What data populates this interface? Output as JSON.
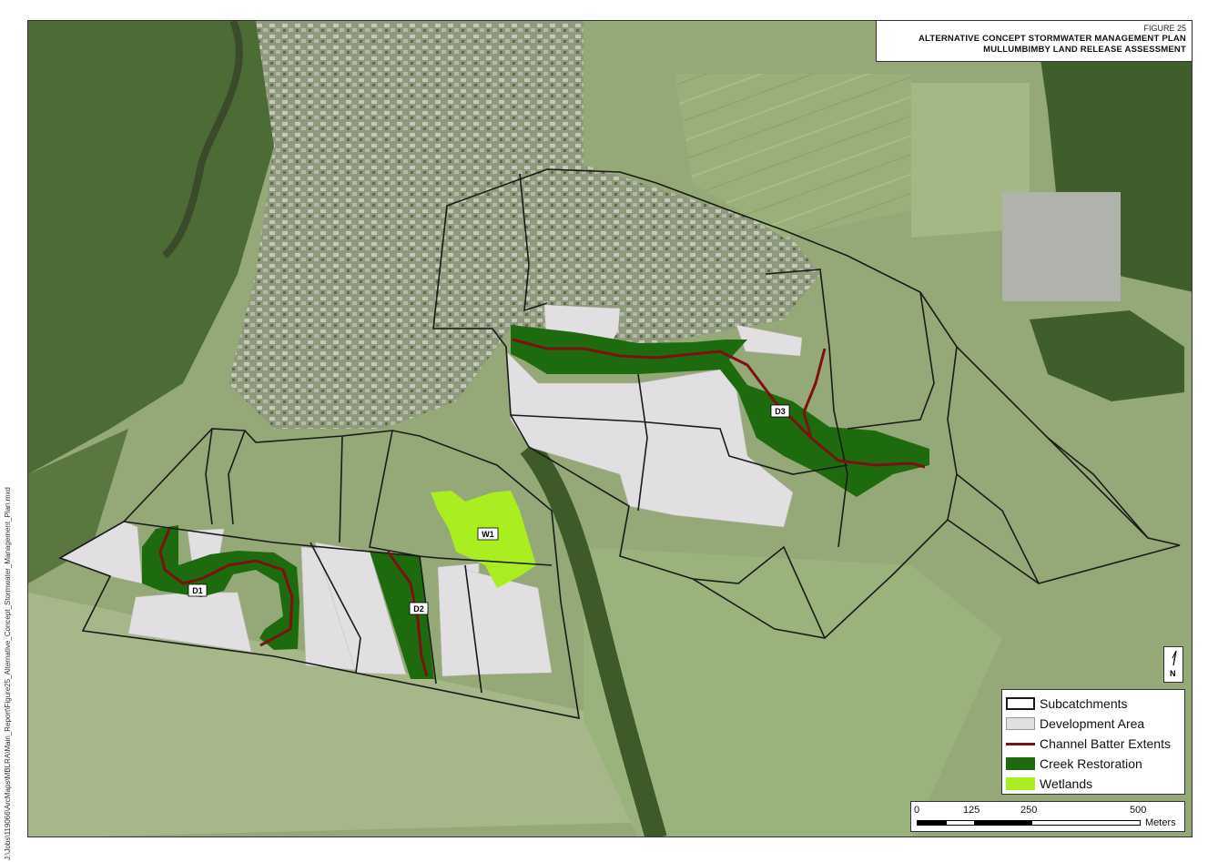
{
  "file_path": "J:\\Jobs\\119066\\ArcMaps\\MBLRA\\Main_Report\\Figure25_Alternative_Concept_Stormwater_Management_Plan.mxd",
  "title": {
    "figure": "FIGURE 25",
    "line1": "ALTERNATIVE CONCEPT STORMWATER MANAGEMENT PLAN",
    "line2": "MULLUMBIMBY LAND RELEASE ASSESSMENT"
  },
  "north_arrow": {
    "label": "N"
  },
  "map_labels": {
    "d1": "D1",
    "d2": "D2",
    "d3": "D3",
    "w1": "W1"
  },
  "legend": {
    "subcatchments": "Subcatchments",
    "development_area": "Development Area",
    "channel_batter": "Channel Batter Extents",
    "creek_restoration": "Creek Restoration",
    "wetlands": "Wetlands"
  },
  "scale": {
    "t0": "0",
    "t1": "125",
    "t2": "250",
    "t3": "500",
    "unit": "Meters"
  },
  "colors": {
    "subcatchment_line": "#1a1a1a",
    "development_area": "#e2dfe3",
    "channel_batter": "#7b1111",
    "creek_restoration": "#1e6b0f",
    "wetlands": "#aaee22"
  }
}
